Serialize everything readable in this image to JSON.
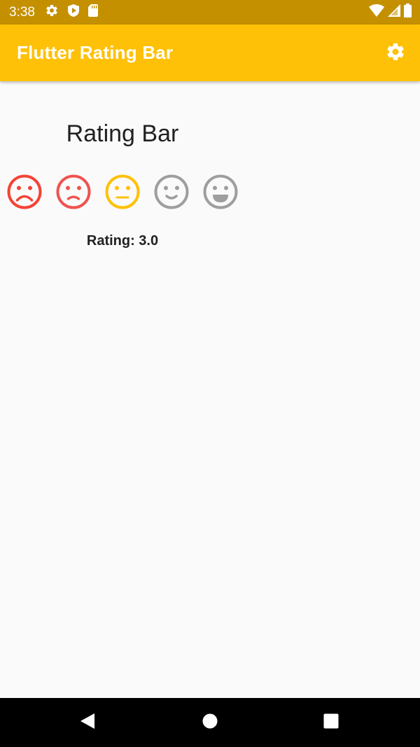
{
  "status_bar": {
    "time": "3:38",
    "left_icons": [
      "gear-icon",
      "shield-play-icon",
      "sd-card-icon"
    ],
    "right_icons": [
      "wifi-icon",
      "cell-signal-icon",
      "battery-icon"
    ]
  },
  "app_bar": {
    "title": "Flutter Rating Bar",
    "action_icon": "settings-icon",
    "color": "#ffc107"
  },
  "content": {
    "heading": "Rating Bar",
    "rating_label": "Rating: 3.0",
    "rating_value": 3.0,
    "rating_max": 5,
    "faces": [
      {
        "name": "very-dissatisfied",
        "color": "#f44336"
      },
      {
        "name": "dissatisfied",
        "color": "#ef5350"
      },
      {
        "name": "neutral",
        "color": "#ffc107"
      },
      {
        "name": "satisfied",
        "color": "#9e9e9e"
      },
      {
        "name": "very-satisfied",
        "color": "#9e9e9e"
      }
    ]
  },
  "nav_bar": {
    "buttons": [
      "back-icon",
      "home-icon",
      "recents-icon"
    ]
  }
}
